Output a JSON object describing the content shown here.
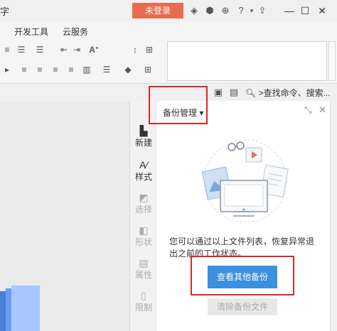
{
  "window": {
    "title_fragment": "字",
    "login_label": "未登录",
    "icons": [
      "skin-icon",
      "hexagon-icon",
      "share-icon",
      "help-icon",
      "upload-icon"
    ],
    "help_label": "?"
  },
  "menu": {
    "items": [
      "开发工具",
      "云服务"
    ]
  },
  "toolbar": {
    "search_label": ">查找命令、搜索..."
  },
  "side_rail": {
    "items": [
      {
        "label": "新建",
        "icon": "new-doc-icon",
        "enabled": true
      },
      {
        "label": "样式",
        "icon": "style-icon",
        "enabled": true
      },
      {
        "label": "选择",
        "icon": "select-icon",
        "enabled": false
      },
      {
        "label": "形状",
        "icon": "shape-icon",
        "enabled": false
      },
      {
        "label": "属性",
        "icon": "property-icon",
        "enabled": false
      },
      {
        "label": "限制",
        "icon": "restrict-icon",
        "enabled": false
      }
    ]
  },
  "panel": {
    "title": "备份管理",
    "info_text": "您可以通过以上文件列表，恢复异常退出之前的工作状态。",
    "primary_button": "查看其他备份",
    "secondary_button": "清除备份文件"
  },
  "colors": {
    "login_bg": "#e96b4f",
    "primary": "#3d8fe0",
    "highlight": "#d9282a"
  }
}
